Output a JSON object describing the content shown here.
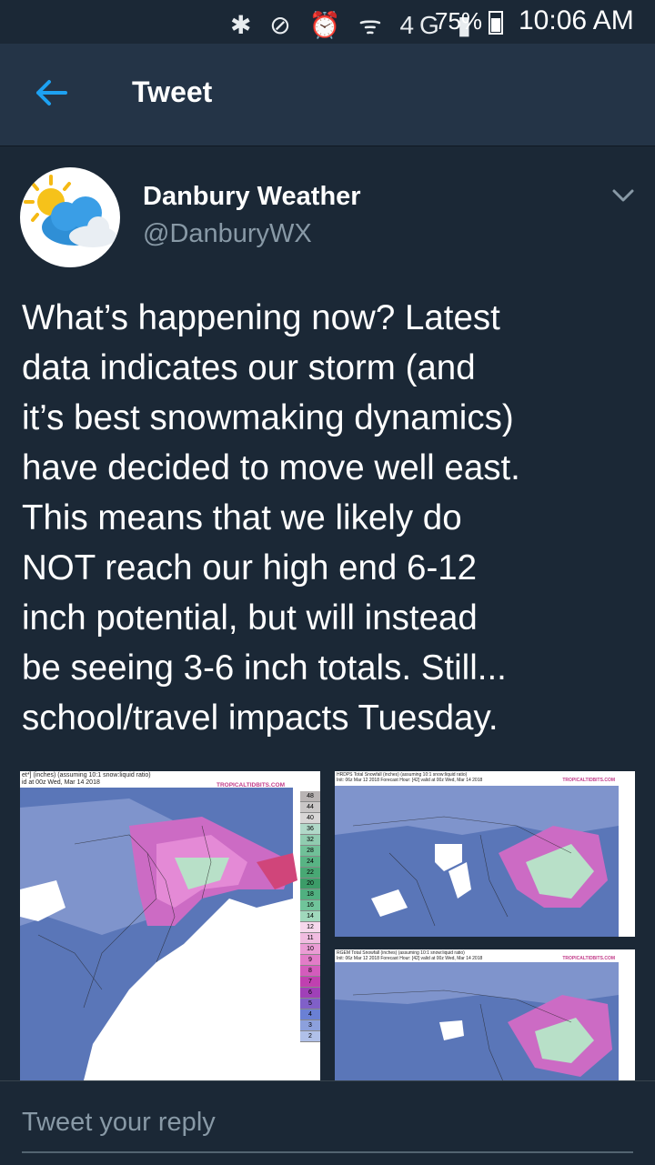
{
  "status_bar": {
    "icons": "✱ ⊘ ⏰ ᯤ 4G ▮",
    "battery": "75%",
    "time": "10:06 AM"
  },
  "header": {
    "title": "Tweet"
  },
  "tweet": {
    "display_name": "Danbury Weather",
    "handle": "@DanburyWX",
    "text": "What’s happening now?  Latest\ndata indicates our storm (and\nit’s best snowmaking dynamics)\nhave decided to move well east.\nThis means that we likely do\nNOT reach our high end 6-12\ninch potential, but will instead\nbe seeing 3-6 inch totals.  Still...\nschool/travel impacts Tuesday."
  },
  "media": {
    "left_caption": "et*] (inches) (assuming 10:1 snow:liquid ratio)\nid at 00z Wed, Mar 14 2018",
    "right_top_caption": "HRDPS Total Snowfall (inches) (assuming 10:1 snow:liquid ratio)\nInit: 06z Mar 12 2018   Forecast Hour: [42]   valid at 00z Wed, Mar 14 2018",
    "right_bottom_caption": "RGEM Total Snowfall (inches) (assuming 10:1 snow:liquid ratio)\nInit: 06z Mar 12 2018   Forecast Hour: [42]   valid at 00z Wed, Mar 14 2018",
    "source": "TROPICALTIDBITS.COM",
    "legend_left": [
      "48",
      "44",
      "40",
      "36",
      "32",
      "28",
      "24",
      "22",
      "20",
      "18",
      "16",
      "14",
      "12",
      "11",
      "10",
      "9",
      "8",
      "7",
      "6",
      "5",
      "4",
      "3",
      "2"
    ]
  },
  "reply": {
    "placeholder": "Tweet your reply"
  }
}
